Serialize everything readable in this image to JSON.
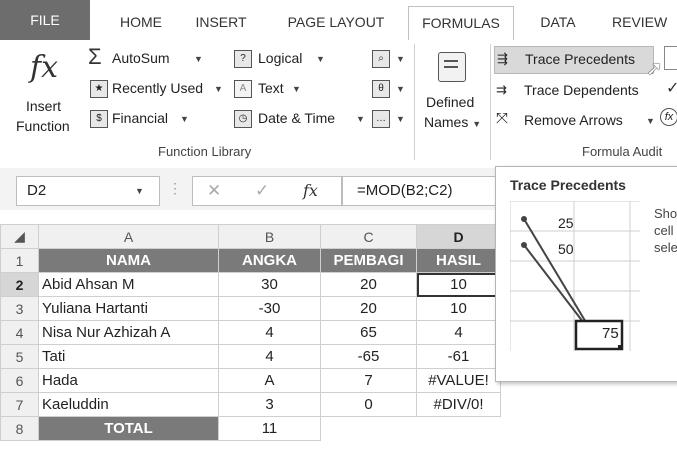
{
  "tabs": {
    "file": "FILE",
    "home": "HOME",
    "insert": "INSERT",
    "page_layout": "PAGE LAYOUT",
    "formulas": "FORMULAS",
    "data": "DATA",
    "review": "REVIEW"
  },
  "ribbon": {
    "insert_function": {
      "icon_glyph": "fx",
      "line1": "Insert",
      "line2": "Function"
    },
    "autosum": "AutoSum",
    "recently_used": "Recently Used",
    "financial": "Financial",
    "logical": "Logical",
    "text": "Text",
    "date_time": "Date & Time",
    "defined_names": {
      "line1": "Defined",
      "line2": "Names"
    },
    "trace_precedents": "Trace Precedents",
    "trace_dependents": "Trace Dependents",
    "remove_arrows": "Remove Arrows",
    "group_function_library": "Function Library",
    "group_formula_auditing": "Formula Audit",
    "autosum_glyph": "Σ",
    "logical_glyph": "?",
    "text_glyph": "A",
    "fx_small": "fx"
  },
  "formula_bar": {
    "name_box": "D2",
    "formula": "=MOD(B2;C2)",
    "fx": "fx",
    "cancel": "✕",
    "enter": "✓",
    "dots": "⋮"
  },
  "columns": [
    "A",
    "B",
    "C",
    "D"
  ],
  "rows": [
    {
      "n": "1",
      "a": "NAMA",
      "b": "ANGKA",
      "c": "PEMBAGI",
      "d": "HASIL"
    },
    {
      "n": "2",
      "a": "Abid Ahsan M",
      "b": "30",
      "c": "20",
      "d": "10"
    },
    {
      "n": "3",
      "a": "Yuliana Hartanti",
      "b": "-30",
      "c": "20",
      "d": "10"
    },
    {
      "n": "4",
      "a": "Nisa Nur Azhizah A",
      "b": "4",
      "c": "65",
      "d": "4"
    },
    {
      "n": "5",
      "a": "Tati",
      "b": "4",
      "c": "-65",
      "d": "-61"
    },
    {
      "n": "6",
      "a": "Hada",
      "b": "A",
      "c": "7",
      "d": "#VALUE!"
    },
    {
      "n": "7",
      "a": "Kaeluddin",
      "b": "3",
      "c": "0",
      "d": "#DIV/0!"
    },
    {
      "n": "8",
      "a": "TOTAL",
      "b": "11",
      "c": "",
      "d": ""
    }
  ],
  "tooltip": {
    "title": "Trace Precedents",
    "val1": "25",
    "val2": "50",
    "result": "75",
    "side1": "Sho",
    "side2": "cell",
    "side3": "sele"
  },
  "colors": {
    "header_fill": "#7a7a7a",
    "file_tab": "#6d6d6d"
  }
}
